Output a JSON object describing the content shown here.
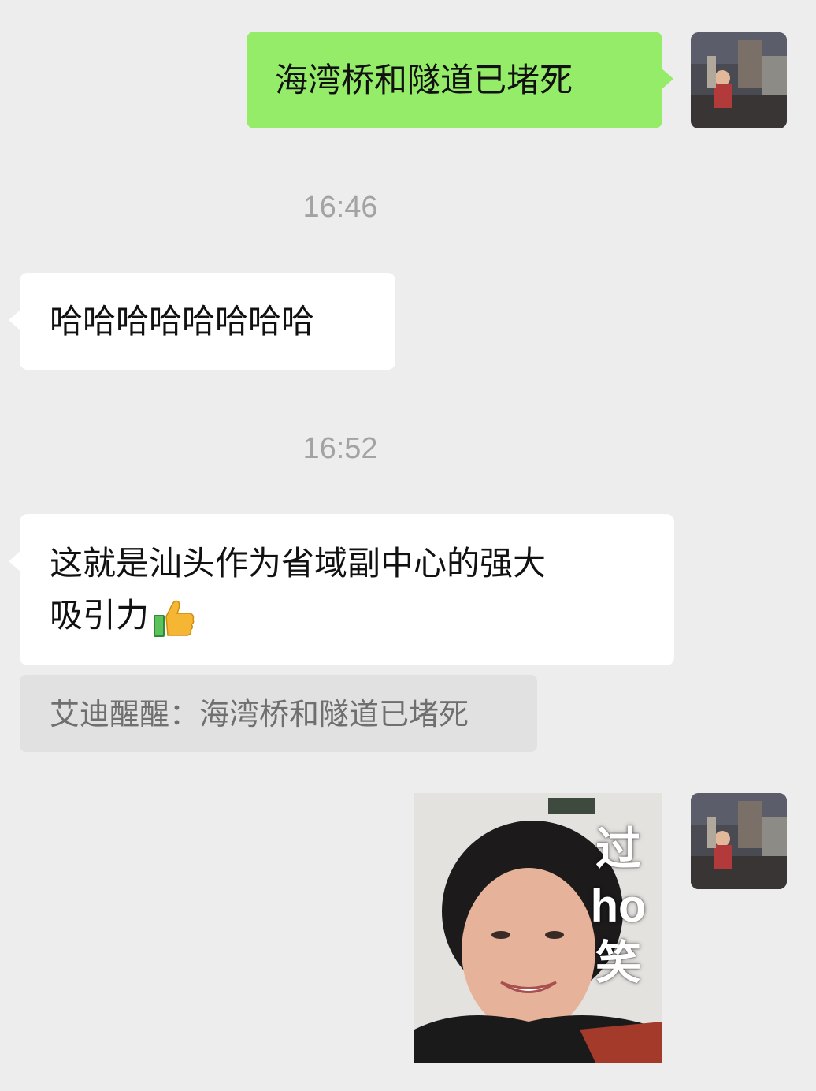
{
  "messages": [
    {
      "type": "sent",
      "text": "海湾桥和隧道已堵死"
    },
    {
      "type": "timestamp",
      "text": "16:46"
    },
    {
      "type": "recv",
      "text": "哈哈哈哈哈哈哈哈"
    },
    {
      "type": "timestamp",
      "text": "16:52"
    },
    {
      "type": "recv",
      "text_line1": "这就是汕头作为省域副中心的强大",
      "text_line2": "吸引力",
      "emoji": "thumbs-up-icon"
    },
    {
      "type": "quote",
      "text": "艾迪醒醒：海湾桥和隧道已堵死"
    },
    {
      "type": "sent-sticker",
      "caption": [
        "过",
        "ho",
        "笑"
      ]
    }
  ],
  "colors": {
    "background": "#ededed",
    "sent_bubble": "#95ec69",
    "recv_bubble": "#ffffff",
    "quote_bg": "#e1e1e1",
    "timestamp": "#a3a3a3"
  }
}
